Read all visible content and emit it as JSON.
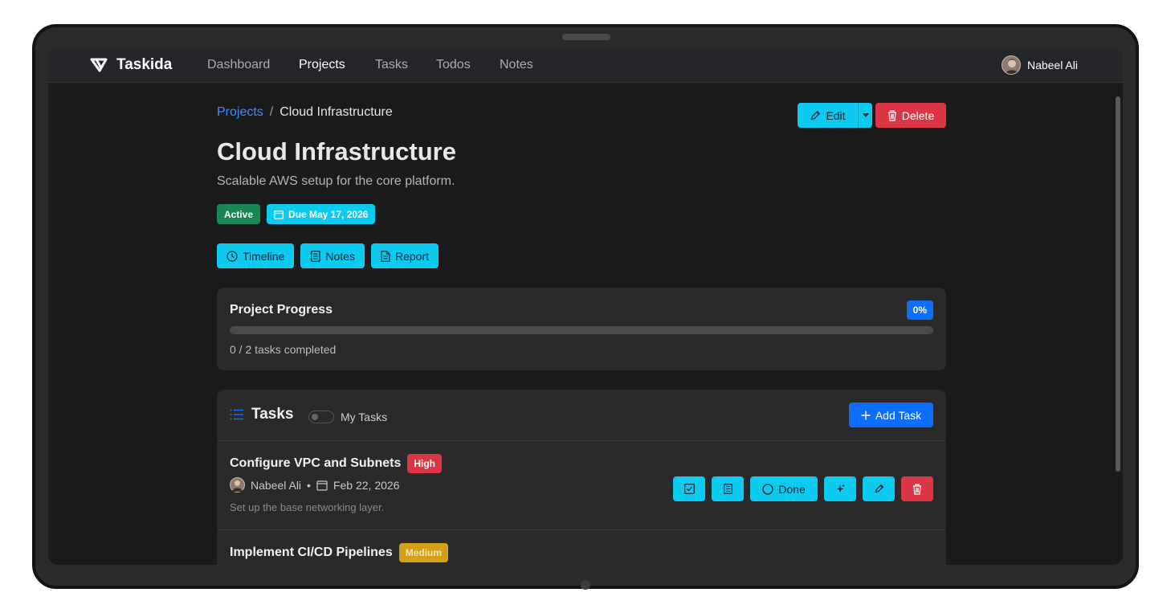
{
  "app": {
    "name": "Taskida"
  },
  "nav": {
    "items": [
      {
        "label": "Dashboard",
        "active": false
      },
      {
        "label": "Projects",
        "active": true
      },
      {
        "label": "Tasks",
        "active": false
      },
      {
        "label": "Todos",
        "active": false
      },
      {
        "label": "Notes",
        "active": false
      }
    ]
  },
  "user": {
    "name": "Nabeel Ali"
  },
  "breadcrumb": {
    "parent": "Projects",
    "separator": "/",
    "current": "Cloud Infrastructure"
  },
  "project": {
    "title": "Cloud Infrastructure",
    "description": "Scalable AWS setup for the core platform.",
    "status": "Active",
    "due": "Due May 17, 2026"
  },
  "actions": {
    "edit": "Edit",
    "delete": "Delete"
  },
  "tabs": [
    {
      "label": "Timeline",
      "icon": "clock-icon"
    },
    {
      "label": "Notes",
      "icon": "journal-icon"
    },
    {
      "label": "Report",
      "icon": "file-icon"
    }
  ],
  "progress": {
    "title": "Project Progress",
    "percent_label": "0%",
    "fraction": 0,
    "summary": "0 / 2 tasks completed"
  },
  "tasks_section": {
    "title": "Tasks",
    "toggle_label": "My Tasks",
    "toggle_on": false,
    "add_label": "Add Task"
  },
  "tasks": [
    {
      "name": "Configure VPC and Subnets",
      "priority": "High",
      "assignee": "Nabeel Ali",
      "bullet": "•",
      "date": "Feb 22, 2026",
      "description": "Set up the base networking layer.",
      "done_label": "Done"
    },
    {
      "name": "Implement CI/CD Pipelines",
      "priority": "Medium"
    }
  ],
  "colors": {
    "accent_cyan": "#0dcaf0",
    "primary_blue": "#0d6efd",
    "danger_red": "#dc3545",
    "success_green": "#198754",
    "warning_yellow": "#d4a017",
    "background": "#1b1b1b",
    "card": "#2a2a2a"
  }
}
